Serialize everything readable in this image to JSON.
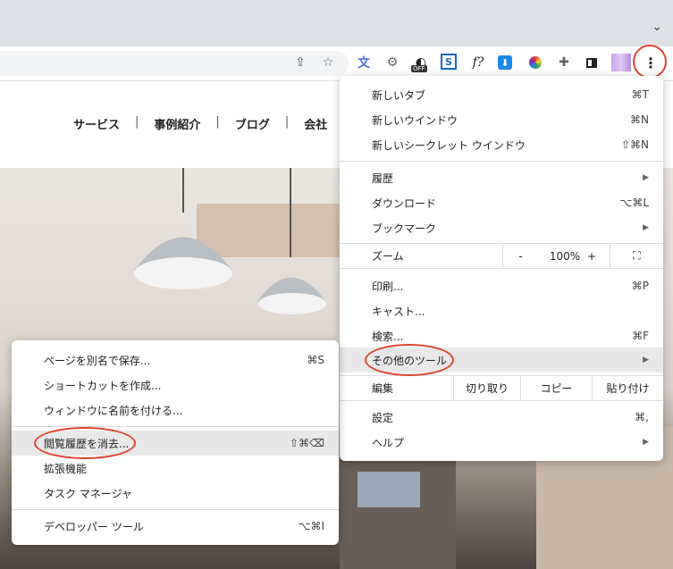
{
  "browser": {
    "extensions": [
      {
        "icon": "translate-icon",
        "glyph": "文",
        "color": "#4a6fd8"
      },
      {
        "icon": "gear-extension-icon",
        "glyph": "⚙",
        "color": "#5f6368"
      },
      {
        "icon": "off-extension-icon",
        "glyph": "◐",
        "color": "#222",
        "badge": "OFF"
      },
      {
        "icon": "s-extension-icon",
        "glyph": "S",
        "color": "#1565c0"
      },
      {
        "icon": "function-extension-icon",
        "glyph": "f?",
        "color": "#222"
      },
      {
        "icon": "download-extension-icon",
        "glyph": "⬇",
        "color": "#1e88e5"
      },
      {
        "icon": "color-wheel-icon",
        "glyph": "✿",
        "color": "#e53935"
      },
      {
        "icon": "puzzle-icon",
        "glyph": "✚",
        "color": "#5f6368"
      },
      {
        "icon": "sidepanel-icon",
        "glyph": "◧",
        "color": "#202124"
      },
      {
        "icon": "profile-avatar",
        "glyph": "",
        "color": "#c9a6e6"
      },
      {
        "icon": "kebab-menu-icon",
        "glyph": "⋮",
        "color": "#202124"
      }
    ]
  },
  "site": {
    "nav": [
      "サービス",
      "事例紹介",
      "ブログ",
      "会社"
    ]
  },
  "main_menu": {
    "new_tab": {
      "label": "新しいタブ",
      "shortcut": "⌘T"
    },
    "new_window": {
      "label": "新しいウインドウ",
      "shortcut": "⌘N"
    },
    "new_incognito": {
      "label": "新しいシークレット ウインドウ",
      "shortcut": "⇧⌘N"
    },
    "history": {
      "label": "履歴"
    },
    "downloads": {
      "label": "ダウンロード",
      "shortcut": "⌥⌘L"
    },
    "bookmarks": {
      "label": "ブックマーク"
    },
    "zoom": {
      "label": "ズーム",
      "minus": "-",
      "value": "100%",
      "plus": "+"
    },
    "print": {
      "label": "印刷...",
      "shortcut": "⌘P"
    },
    "cast": {
      "label": "キャスト..."
    },
    "find": {
      "label": "検索...",
      "shortcut": "⌘F"
    },
    "more_tools": {
      "label": "その他のツール"
    },
    "edit": {
      "label": "編集",
      "cut": "切り取り",
      "copy": "コピー",
      "paste": "貼り付け"
    },
    "settings": {
      "label": "設定",
      "shortcut": "⌘,"
    },
    "help": {
      "label": "ヘルプ"
    }
  },
  "sub_menu": {
    "save_page": {
      "label": "ページを別名で保存...",
      "shortcut": "⌘S"
    },
    "create_shortcut": {
      "label": "ショートカットを作成..."
    },
    "name_window": {
      "label": "ウィンドウに名前を付ける..."
    },
    "clear_history": {
      "label": "閲覧履歴を消去...",
      "shortcut": "⇧⌘⌫"
    },
    "extensions": {
      "label": "拡張機能"
    },
    "task_manager": {
      "label": "タスク マネージャ"
    },
    "dev_tools": {
      "label": "デベロッパー ツール",
      "shortcut": "⌥⌘I"
    }
  },
  "colors": {
    "annotation": "#e0452d",
    "highlight": "#e8e8e8"
  }
}
